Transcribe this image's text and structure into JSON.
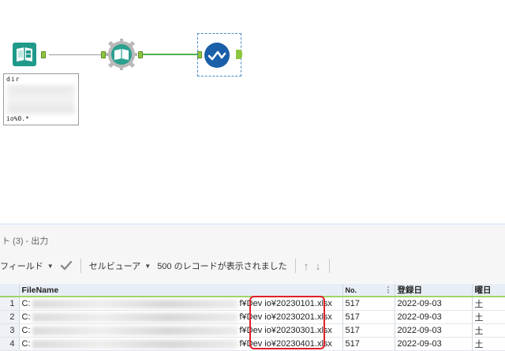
{
  "workflow": {
    "tools": [
      {
        "name": "directory-tool",
        "icon": "directory-book-icon"
      },
      {
        "name": "dynamic-input-tool",
        "icon": "open-book-gear-icon"
      },
      {
        "name": "browse-tool",
        "icon": "browse-checkmark-icon"
      }
    ],
    "annotation": {
      "top_text": "dir",
      "bottom_text": "io%0.*"
    }
  },
  "results": {
    "title": "ト (3) - 出力",
    "toolbar": {
      "field_label": "フィールド",
      "cell_viewer_label": "セルビューア",
      "record_count_text": "500 のレコードが表示されました",
      "up_arrow": "↑",
      "down_arrow": "↓"
    },
    "columns": [
      "FileName",
      "No.",
      "登録日",
      "曜日"
    ],
    "rows": [
      {
        "n": "1",
        "file_start": "C:",
        "file_end": "f¥Dev io¥20230101.xlsx",
        "no": "517",
        "date": "2022-09-03",
        "day": "土"
      },
      {
        "n": "2",
        "file_start": "C:",
        "file_end": "f¥Dev io¥20230201.xlsx",
        "no": "517",
        "date": "2022-09-03",
        "day": "土"
      },
      {
        "n": "3",
        "file_start": "C:",
        "file_end": "f¥Dev io¥20230301.xlsx",
        "no": "517",
        "date": "2022-09-03",
        "day": "土"
      },
      {
        "n": "4",
        "file_start": "C:",
        "file_end": "f¥Dev io¥20230401.xlsx",
        "no": "517",
        "date": "2022-09-03",
        "day": "土"
      }
    ]
  },
  "colors": {
    "accent_green": "#8dc63f",
    "input_teal": "#1f9a8a",
    "browse_blue": "#1a5fa8",
    "highlight_red": "#e0202a"
  }
}
